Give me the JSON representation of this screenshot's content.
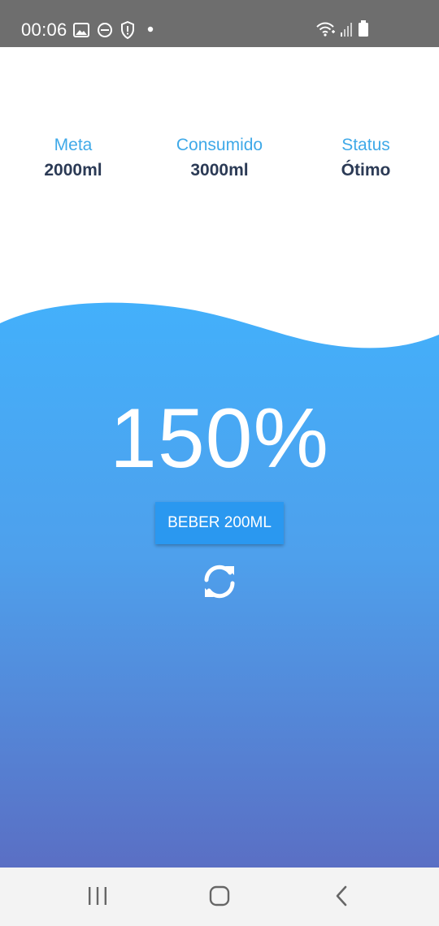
{
  "status_bar": {
    "time": "00:06",
    "left_icons": [
      "image-icon",
      "do-not-disturb-icon",
      "shield-icon",
      "dot-icon"
    ],
    "right_icons": [
      "wifi-icon",
      "signal-icon",
      "battery-icon"
    ]
  },
  "stats": {
    "meta": {
      "label": "Meta",
      "value": "2000ml"
    },
    "consumido": {
      "label": "Consumido",
      "value": "3000ml"
    },
    "status": {
      "label": "Status",
      "value": "Ótimo"
    }
  },
  "progress": {
    "percent_text": "150%"
  },
  "actions": {
    "drink_label": "BEBER 200ML",
    "reset_icon": "refresh-icon"
  },
  "nav_bar": {
    "items": [
      "recents-icon",
      "home-icon",
      "back-icon"
    ]
  },
  "colors": {
    "label_blue": "#3fa9e8",
    "value_dark": "#2b3a55",
    "water_top": "#43b0fb",
    "water_bottom": "#5a6fc4",
    "button": "#2a98f0"
  }
}
